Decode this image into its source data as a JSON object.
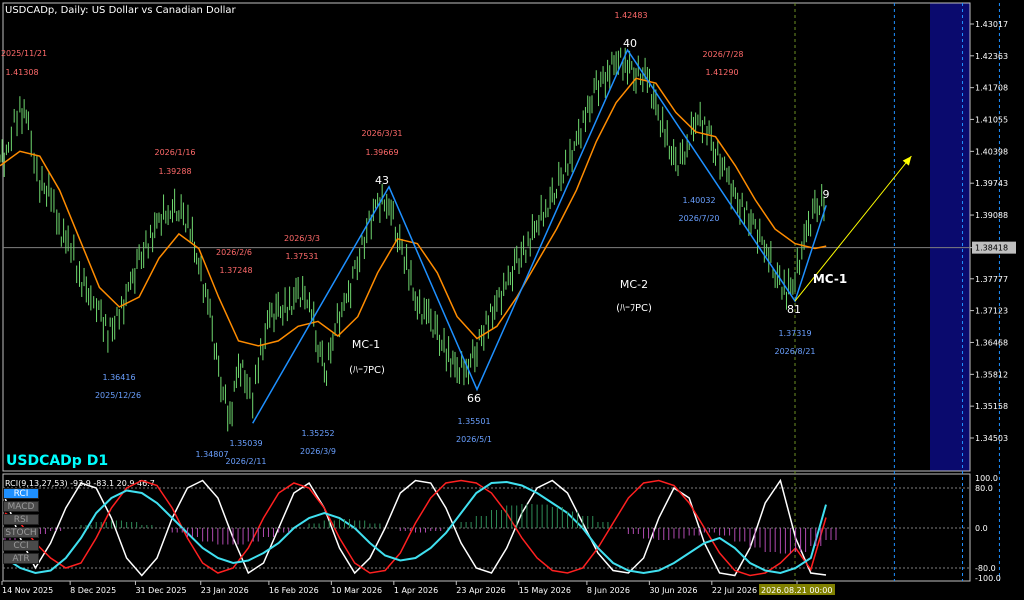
{
  "chart_title": "USDCADp, Daily:  US Dollar vs Canadian Dollar",
  "symbol_label": "USDCADp D1",
  "chart_data": {
    "type": "line",
    "series": [
      {
        "points": [
          [
            "2025-11-14",
            1.4025
          ],
          [
            "2025-11-17",
            1.4035
          ],
          [
            "2025-11-19",
            1.4095
          ],
          [
            "2025-11-21",
            1.4125
          ],
          [
            "2025-11-24",
            1.4105
          ],
          [
            "2025-11-26",
            1.403
          ],
          [
            "2025-11-28",
            1.3975
          ],
          [
            "2025-12-02",
            1.395
          ],
          [
            "2025-12-04",
            1.389
          ],
          [
            "2025-12-08",
            1.3845
          ],
          [
            "2025-12-10",
            1.3825
          ],
          [
            "2025-12-12",
            1.378
          ],
          [
            "2025-12-16",
            1.3745
          ],
          [
            "2025-12-18",
            1.373
          ],
          [
            "2025-12-22",
            1.3665
          ],
          [
            "2025-12-26",
            1.37
          ],
          [
            "2025-12-30",
            1.3765
          ],
          [
            "2026-01-02",
            1.3815
          ],
          [
            "2026-01-06",
            1.386
          ],
          [
            "2026-01-09",
            1.39
          ],
          [
            "2026-01-13",
            1.392
          ],
          [
            "2026-01-16",
            1.3925
          ],
          [
            "2026-01-20",
            1.388
          ],
          [
            "2026-01-23",
            1.3805
          ],
          [
            "2026-01-27",
            1.3705
          ],
          [
            "2026-01-30",
            1.358
          ],
          [
            "2026-02-03",
            1.349
          ],
          [
            "2026-02-06",
            1.36
          ],
          [
            "2026-02-09",
            1.357
          ],
          [
            "2026-02-11",
            1.3535
          ],
          [
            "2026-02-13",
            1.36
          ],
          [
            "2026-02-17",
            1.37
          ],
          [
            "2026-02-20",
            1.371
          ],
          [
            "2026-02-24",
            1.372
          ],
          [
            "2026-02-27",
            1.375
          ],
          [
            "2026-03-03",
            1.3735
          ],
          [
            "2026-03-06",
            1.364
          ],
          [
            "2026-03-09",
            1.359
          ],
          [
            "2026-03-12",
            1.368
          ],
          [
            "2026-03-16",
            1.373
          ],
          [
            "2026-03-19",
            1.379
          ],
          [
            "2026-03-24",
            1.389
          ],
          [
            "2026-03-27",
            1.3935
          ],
          [
            "2026-03-31",
            1.3935
          ],
          [
            "2026-04-03",
            1.387
          ],
          [
            "2026-04-07",
            1.379
          ],
          [
            "2026-04-10",
            1.372
          ],
          [
            "2026-04-14",
            1.37
          ],
          [
            "2026-04-17",
            1.366
          ],
          [
            "2026-04-21",
            1.362
          ],
          [
            "2026-04-24",
            1.359
          ],
          [
            "2026-04-28",
            1.36
          ],
          [
            "2026-05-01",
            1.364
          ],
          [
            "2026-05-05",
            1.369
          ],
          [
            "2026-05-08",
            1.373
          ],
          [
            "2026-05-12",
            1.377
          ],
          [
            "2026-05-15",
            1.381
          ],
          [
            "2026-05-19",
            1.385
          ],
          [
            "2026-05-22",
            1.389
          ],
          [
            "2026-05-26",
            1.393
          ],
          [
            "2026-05-29",
            1.397
          ],
          [
            "2026-06-02",
            1.401
          ],
          [
            "2026-06-05",
            1.406
          ],
          [
            "2026-06-09",
            1.412
          ],
          [
            "2026-06-12",
            1.417
          ],
          [
            "2026-06-16",
            1.42
          ],
          [
            "2026-06-19",
            1.423
          ],
          [
            "2026-06-23",
            1.422
          ],
          [
            "2026-06-26",
            1.42
          ],
          [
            "2026-06-30",
            1.419
          ],
          [
            "2026-07-03",
            1.413
          ],
          [
            "2026-07-07",
            1.406
          ],
          [
            "2026-07-10",
            1.401
          ],
          [
            "2026-07-14",
            1.405
          ],
          [
            "2026-07-17",
            1.411
          ],
          [
            "2026-07-21",
            1.409
          ],
          [
            "2026-07-24",
            1.404
          ],
          [
            "2026-07-28",
            1.399
          ],
          [
            "2026-07-31",
            1.394
          ],
          [
            "2026-08-04",
            1.391
          ],
          [
            "2026-08-07",
            1.388
          ],
          [
            "2026-08-11",
            1.384
          ],
          [
            "2026-08-14",
            1.379
          ],
          [
            "2026-08-18",
            1.375
          ],
          [
            "2026-08-21",
            1.378
          ],
          [
            "2026-08-25",
            1.387
          ],
          [
            "2026-08-28",
            1.392
          ],
          [
            "2026-09-01",
            1.394
          ]
        ],
        "color": "#90ee90"
      },
      {
        "points": [
          [
            "2025-11-14",
            1.401
          ],
          [
            "2025-11-21",
            1.404
          ],
          [
            "2025-11-28",
            1.403
          ],
          [
            "2025-12-05",
            1.396
          ],
          [
            "2025-12-12",
            1.386
          ],
          [
            "2025-12-19",
            1.376
          ],
          [
            "2025-12-26",
            1.372
          ],
          [
            "2026-01-02",
            1.374
          ],
          [
            "2026-01-09",
            1.382
          ],
          [
            "2026-01-16",
            1.387
          ],
          [
            "2026-01-23",
            1.384
          ],
          [
            "2026-01-30",
            1.374
          ],
          [
            "2026-02-06",
            1.365
          ],
          [
            "2026-02-13",
            1.364
          ],
          [
            "2026-02-20",
            1.365
          ],
          [
            "2026-02-27",
            1.368
          ],
          [
            "2026-03-06",
            1.369
          ],
          [
            "2026-03-13",
            1.366
          ],
          [
            "2026-03-20",
            1.37
          ],
          [
            "2026-03-27",
            1.379
          ],
          [
            "2026-04-03",
            1.386
          ],
          [
            "2026-04-10",
            1.385
          ],
          [
            "2026-04-17",
            1.379
          ],
          [
            "2026-04-24",
            1.37
          ],
          [
            "2026-05-01",
            1.3655
          ],
          [
            "2026-05-08",
            1.368
          ],
          [
            "2026-05-15",
            1.374
          ],
          [
            "2026-05-22",
            1.381
          ],
          [
            "2026-05-29",
            1.388
          ],
          [
            "2026-06-05",
            1.396
          ],
          [
            "2026-06-12",
            1.406
          ],
          [
            "2026-06-19",
            1.414
          ],
          [
            "2026-06-26",
            1.419
          ],
          [
            "2026-07-03",
            1.418
          ],
          [
            "2026-07-10",
            1.412
          ],
          [
            "2026-07-17",
            1.408
          ],
          [
            "2026-07-24",
            1.407
          ],
          [
            "2026-07-31",
            1.401
          ],
          [
            "2026-08-07",
            1.394
          ],
          [
            "2026-08-14",
            1.388
          ],
          [
            "2026-08-21",
            1.385
          ],
          [
            "2026-08-28",
            1.384
          ],
          [
            "2026-09-01",
            1.3845
          ]
        ],
        "color": "#ff8c00"
      }
    ],
    "zigzag": [
      [
        "2026-02-11",
        1.34807
      ],
      [
        "2026-03-31",
        1.39669
      ],
      [
        "2026-05-01",
        1.35501
      ],
      [
        "2026-06-23",
        1.42483
      ],
      [
        "2026-08-21",
        1.37319
      ],
      [
        "2026-09-01",
        1.39288
      ]
    ],
    "zigzag_labels": [
      "43",
      "66",
      "40",
      "81",
      "9"
    ],
    "projection": [
      [
        "2026-08-21",
        1.37319
      ],
      [
        "2026-10-01",
        1.403
      ]
    ],
    "current_price": 1.38418,
    "y_ticks": [
      "1.43017",
      "1.42363",
      "1.41708",
      "1.41055",
      "1.40398",
      "1.39743",
      "1.39088",
      "1.38418",
      "1.37777",
      "1.37123",
      "1.36468",
      "1.35812",
      "1.35158",
      "1.34503"
    ],
    "x_ticks": [
      "14 Nov 2025",
      "8 Dec 2025",
      "31 Dec 2025",
      "23 Jan 2026",
      "16 Feb 2026",
      "10 Mar 2026",
      "1 Apr 2026",
      "23 Apr 2026",
      "15 May 2026",
      "8 Jun 2026",
      "30 Jun 2026",
      "22 Jul 2026",
      "2026.08.21 00:00"
    ],
    "highs": [
      {
        "date": "2025/11/21",
        "price": "1.41308"
      },
      {
        "date": "2026/1/16",
        "price": "1.39288"
      },
      {
        "date": "2026/2/6",
        "price": "1.37248"
      },
      {
        "date": "2026/3/3",
        "price": "1.37531"
      },
      {
        "date": "2026/3/31",
        "price": "1.39669"
      },
      {
        "date": "",
        "price": "1.42483"
      },
      {
        "date": "2026/7/28",
        "price": "1.41290"
      }
    ],
    "lows": [
      {
        "price": "1.36416",
        "date": "2025/12/26"
      },
      {
        "price": "1.35039",
        "date": "2026/2/11"
      },
      {
        "price": "1.34807",
        "date": ""
      },
      {
        "price": "1.35252",
        "date": "2026/3/9"
      },
      {
        "price": "1.35501",
        "date": "2026/5/1"
      },
      {
        "price": "1.40032",
        "date": "2026/7/20"
      },
      {
        "price": "1.37319",
        "date": "2026/8/21"
      }
    ],
    "annotations": [
      {
        "title": "MC-1",
        "subtitle": "(ﾊｰﾌPC)"
      },
      {
        "title": "MC-2",
        "subtitle": "(ﾊｰﾌPC)"
      },
      {
        "title": "MC-1",
        "subtitle": ""
      }
    ]
  },
  "indicator": {
    "label": "RCI(9,13,27,53) -93.9 -83.1 20.9 46.7",
    "buttons": [
      "RCI",
      "MACD",
      "RSI",
      "STOCH",
      "CCI",
      "ATR"
    ],
    "active": "RCI",
    "y_ticks": [
      "100.0",
      "80.0",
      "0.0",
      "-80.0",
      "-100.0"
    ],
    "series": [
      {
        "name": "RCI 9",
        "color": "#ffffff",
        "values": [
          60,
          -20,
          -80,
          -30,
          40,
          90,
          80,
          20,
          -60,
          -95,
          -60,
          20,
          80,
          95,
          60,
          -20,
          -90,
          -70,
          0,
          70,
          90,
          40,
          -40,
          -90,
          -60,
          0,
          70,
          95,
          90,
          40,
          -30,
          -80,
          -90,
          -40,
          30,
          80,
          95,
          70,
          10,
          -50,
          -85,
          -90,
          -60,
          20,
          80,
          60,
          -30,
          -90,
          -95,
          -40,
          50,
          95,
          -20,
          -90,
          -93.9
        ]
      },
      {
        "name": "RCI 13",
        "color": "#ff2020",
        "values": [
          30,
          10,
          -30,
          -60,
          -80,
          -70,
          -20,
          40,
          80,
          95,
          85,
          40,
          -20,
          -70,
          -90,
          -80,
          -40,
          20,
          70,
          90,
          80,
          40,
          -20,
          -70,
          -90,
          -85,
          -50,
          10,
          60,
          90,
          95,
          90,
          70,
          30,
          -20,
          -60,
          -85,
          -90,
          -80,
          -40,
          10,
          60,
          90,
          95,
          85,
          50,
          0,
          -50,
          -85,
          -95,
          -90,
          -70,
          -40,
          -83.1,
          20.9
        ]
      },
      {
        "name": "RCI 27",
        "color": "#40e0f0",
        "values": [
          -60,
          -80,
          -90,
          -85,
          -60,
          -20,
          30,
          60,
          75,
          70,
          50,
          20,
          -10,
          -40,
          -60,
          -70,
          -65,
          -50,
          -30,
          0,
          20,
          30,
          20,
          0,
          -30,
          -55,
          -65,
          -60,
          -40,
          -10,
          30,
          70,
          90,
          92,
          85,
          70,
          50,
          30,
          0,
          -40,
          -70,
          -85,
          -90,
          -85,
          -70,
          -50,
          -30,
          -20,
          -40,
          -70,
          -85,
          -90,
          -80,
          -60,
          46.7
        ]
      },
      {
        "name": "RCI 53",
        "color": "#c060c0",
        "values": [
          -40,
          -30,
          -20,
          -10,
          0,
          10,
          20,
          25,
          20,
          10,
          0,
          -15,
          -30,
          -45,
          -55,
          -55,
          -45,
          -30,
          -15,
          0,
          15,
          25,
          30,
          25,
          15,
          0,
          -10,
          -15,
          -10,
          0,
          20,
          40,
          60,
          75,
          80,
          78,
          70,
          55,
          40,
          20,
          0,
          -20,
          -35,
          -40,
          -35,
          -25,
          -15,
          -25,
          -45,
          -65,
          -80,
          -85,
          -80,
          -60,
          -40
        ]
      }
    ]
  }
}
